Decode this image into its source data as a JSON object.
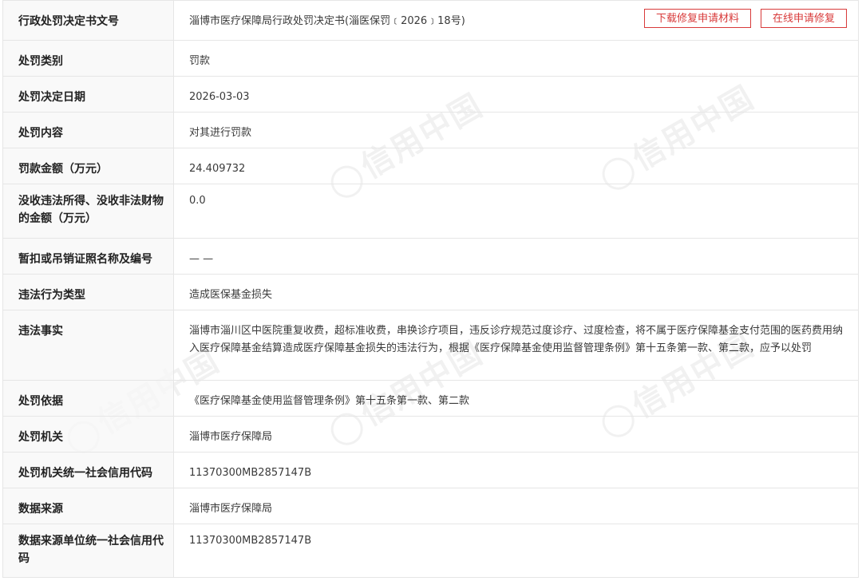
{
  "rows": [
    {
      "label": "行政处罚决定书文号",
      "value": "淄博市医疗保障局行政处罚决定书(淄医保罚﹝2026﹞18号)"
    },
    {
      "label": "处罚类别",
      "value": "罚款"
    },
    {
      "label": "处罚决定日期",
      "value": "2026-03-03"
    },
    {
      "label": "处罚内容",
      "value": "对其进行罚款"
    },
    {
      "label": "罚款金额（万元）",
      "value": "24.409732"
    },
    {
      "label": "没收违法所得、没收非法财物的金额（万元）",
      "value": "0.0"
    },
    {
      "label": "暂扣或吊销证照名称及编号",
      "value": "— —"
    },
    {
      "label": "违法行为类型",
      "value": "造成医保基金损失"
    },
    {
      "label": "违法事实",
      "value": "淄博市淄川区中医院重复收费，超标准收费，串换诊疗项目，违反诊疗规范过度诊疗、过度检查，将不属于医疗保障基金支付范围的医药费用纳入医疗保障基金结算造成医疗保障基金损失的违法行为，根据《医疗保障基金使用监督管理条例》第十五条第一款、第二款，应予以处罚"
    },
    {
      "label": "处罚依据",
      "value": "《医疗保障基金使用监督管理条例》第十五条第一款、第二款"
    },
    {
      "label": "处罚机关",
      "value": "淄博市医疗保障局"
    },
    {
      "label": "处罚机关统一社会信用代码",
      "value": "11370300MB2857147B"
    },
    {
      "label": "数据来源",
      "value": "淄博市医疗保障局"
    },
    {
      "label": "数据来源单位统一社会信用代码",
      "value": "11370300MB2857147B"
    }
  ],
  "actions": {
    "download_label": "下载修复申请材料",
    "apply_label": "在线申请修复"
  },
  "watermark": {
    "text": "信用中国"
  },
  "colors": {
    "accent": "#d83a3a",
    "border": "#e6e6e6",
    "label_bg": "#f7f7f7"
  }
}
